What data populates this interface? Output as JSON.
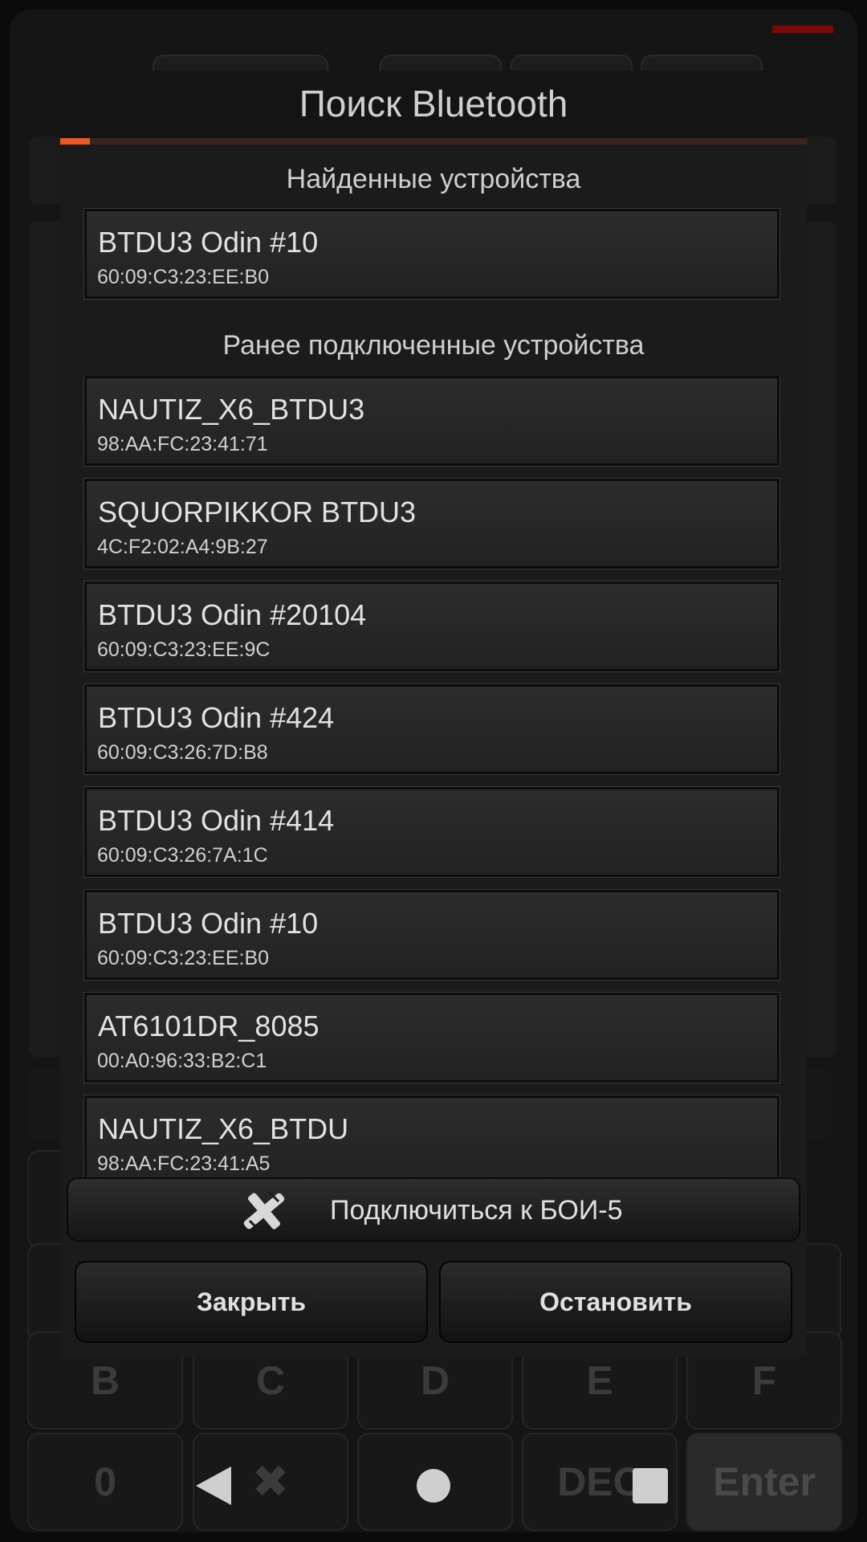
{
  "dialog": {
    "title": "Поиск Bluetooth",
    "scan_progress": 0.04,
    "found_section_title": "Найденные устройства",
    "previous_section_title": "Ранее подключенные устройства",
    "found_devices": [
      {
        "name": "BTDU3 Odin #10",
        "mac": "60:09:C3:23:EE:B0"
      }
    ],
    "previous_devices": [
      {
        "name": "NAUTIZ_X6_BTDU3",
        "mac": "98:AA:FC:23:41:71"
      },
      {
        "name": "SQUORPIKKOR BTDU3",
        "mac": "4C:F2:02:A4:9B:27"
      },
      {
        "name": "BTDU3 Odin #20104",
        "mac": "60:09:C3:23:EE:9C"
      },
      {
        "name": "BTDU3 Odin #424",
        "mac": "60:09:C3:26:7D:B8"
      },
      {
        "name": "BTDU3 Odin #414",
        "mac": "60:09:C3:26:7A:1C"
      },
      {
        "name": "BTDU3 Odin #10",
        "mac": "60:09:C3:23:EE:B0"
      },
      {
        "name": "AT6101DR_8085",
        "mac": "00:A0:96:33:B2:C1"
      },
      {
        "name": "NAUTIZ_X6_BTDU",
        "mac": "98:AA:FC:23:41:A5"
      }
    ],
    "connect_button": {
      "label": "Подключиться к БОИ-5",
      "icon": "bluetooth-connect-icon"
    },
    "close_button": "Закрыть",
    "stop_button": "Остановить"
  },
  "background_keys": {
    "row1": [
      "B",
      "C",
      "D",
      "E",
      "F"
    ],
    "row2": [
      "0",
      "DEC",
      "Enter"
    ]
  },
  "nav_bar": {
    "back_icon": "back-triangle-icon",
    "home_icon": "home-circle-icon",
    "recents_icon": "recents-square-icon"
  },
  "colors": {
    "accent": "#e85a26",
    "background": "#151515",
    "dialog": "#1b1b1b"
  }
}
